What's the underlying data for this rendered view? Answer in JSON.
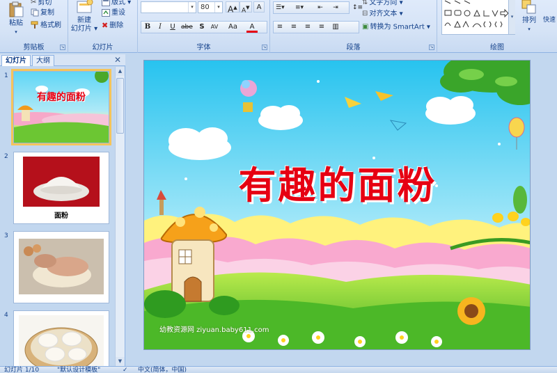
{
  "ribbon": {
    "clipboard": {
      "label": "剪贴板",
      "paste": "粘贴",
      "cut": "剪切",
      "copy": "复制",
      "format_painter": "格式刷"
    },
    "slides": {
      "label": "幻灯片",
      "new_slide_line1": "新建",
      "new_slide_line2": "幻灯片 ▾",
      "layout": "版式 ▾",
      "reset": "重设",
      "delete": "删除"
    },
    "font": {
      "label": "字体",
      "font_name": "",
      "font_size": "80",
      "grow": "A",
      "shrink": "A",
      "clear": "A",
      "bold": "B",
      "italic": "I",
      "underline": "U",
      "strike": "abe",
      "shadow": "S",
      "spacing": "AV",
      "case": "Aa",
      "color": "A"
    },
    "paragraph": {
      "label": "段落",
      "text_direction": "文字方向 ▾",
      "align_text": "对齐文本 ▾",
      "smartart": "转换为 SmartArt ▾"
    },
    "drawing": {
      "label": "绘图",
      "arrange": "排列",
      "quick_styles": "快速"
    }
  },
  "pane": {
    "tab_slides": "幻灯片",
    "tab_outline": "大纲",
    "close": "✕",
    "thumbnails": [
      {
        "num": "1",
        "caption": "有趣的面粉"
      },
      {
        "num": "2",
        "caption": "面粉"
      },
      {
        "num": "3",
        "caption": ""
      },
      {
        "num": "4",
        "caption": ""
      }
    ]
  },
  "slide": {
    "title": "有趣的面粉",
    "watermark": "幼教资源网 ziyuan.baby611.com"
  },
  "status": {
    "slide_count": "幻灯片 1/10",
    "theme": "\"默认设计模板\"",
    "language": "中文(简体，中国)"
  },
  "colors": {
    "title_red": "#e60012",
    "ribbon_blue": "#15428b",
    "selection": "#f5c45b"
  }
}
